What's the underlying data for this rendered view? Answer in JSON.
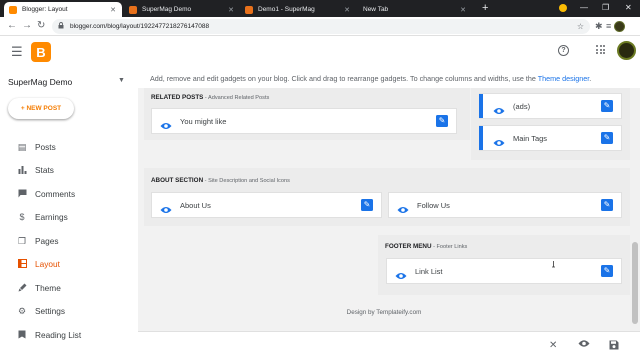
{
  "browser": {
    "tabs": [
      {
        "title": "Blogger: Layout",
        "active": true,
        "favicon_color": "#ff8a00"
      },
      {
        "title": "SuperMag Demo",
        "active": false,
        "favicon_color": "#e8711b"
      },
      {
        "title": "Demo1 - SuperMag",
        "active": false,
        "favicon_color": "#e8711b"
      },
      {
        "title": "New Tab",
        "active": false,
        "favicon_color": ""
      }
    ],
    "new_tab_symbol": "+",
    "url": "blogger.com/blog/layout/1922477218276147088",
    "back_symbol": "←",
    "forward_symbol": "→",
    "reload_symbol": "↻",
    "minimize_symbol": "—",
    "maximize_symbol": "❐",
    "close_symbol": "✕",
    "tab_close_symbol": "✕",
    "star_symbol": "☆",
    "extensions_symbol": "✱",
    "media_symbol": "≡",
    "lock_symbol": "🔒"
  },
  "header": {
    "logo_letter": "B",
    "help_symbol": "?",
    "accent_color": "#ff8a00"
  },
  "sidebar": {
    "blog_name": "SuperMag Demo",
    "caret": "▼",
    "new_post_label": "+ NEW POST",
    "items": [
      {
        "label": "Posts",
        "icon": "posts-icon",
        "glyph": "▤",
        "active": false
      },
      {
        "label": "Stats",
        "icon": "stats-icon",
        "glyph": "▮",
        "active": false
      },
      {
        "label": "Comments",
        "icon": "comments-icon",
        "glyph": "▬",
        "active": false
      },
      {
        "label": "Earnings",
        "icon": "earnings-icon",
        "glyph": "$",
        "active": false
      },
      {
        "label": "Pages",
        "icon": "pages-icon",
        "glyph": "❐",
        "active": false
      },
      {
        "label": "Layout",
        "icon": "layout-icon",
        "glyph": "▥",
        "active": true
      },
      {
        "label": "Theme",
        "icon": "theme-icon",
        "glyph": "✎",
        "active": false
      },
      {
        "label": "Settings",
        "icon": "settings-icon",
        "glyph": "⚙",
        "active": false
      },
      {
        "label": "Reading List",
        "icon": "reading-list-icon",
        "glyph": "▮",
        "active": false
      }
    ]
  },
  "main": {
    "instructions_prefix": "Add, remove and edit gadgets on your blog. Click and drag to rearrange gadgets. To change columns and widths, use the ",
    "instructions_link": "Theme designer",
    "instructions_suffix": ".",
    "sections": {
      "related_posts": {
        "title": "RELATED POSTS",
        "subtitle": " - Advanced Related Posts",
        "gadgets": [
          {
            "name": "You might like"
          }
        ]
      },
      "sidebar_right": {
        "gadgets": [
          {
            "name": "(ads)"
          },
          {
            "name": "Main Tags"
          }
        ]
      },
      "about": {
        "title": "ABOUT SECTION",
        "subtitle": " - Site Description and Social Icons",
        "gadgets": [
          {
            "name": "About Us"
          },
          {
            "name": "Follow Us"
          }
        ]
      },
      "footer_menu": {
        "title": "FOOTER MENU",
        "subtitle": " - Footer Links",
        "gadgets": [
          {
            "name": "Link List"
          }
        ]
      }
    },
    "design_by": "Design by Templateify.com",
    "edit_symbol": "✎"
  },
  "bottombar": {
    "close_symbol": "✕",
    "preview_symbol": "◉",
    "save_symbol": "▣"
  }
}
